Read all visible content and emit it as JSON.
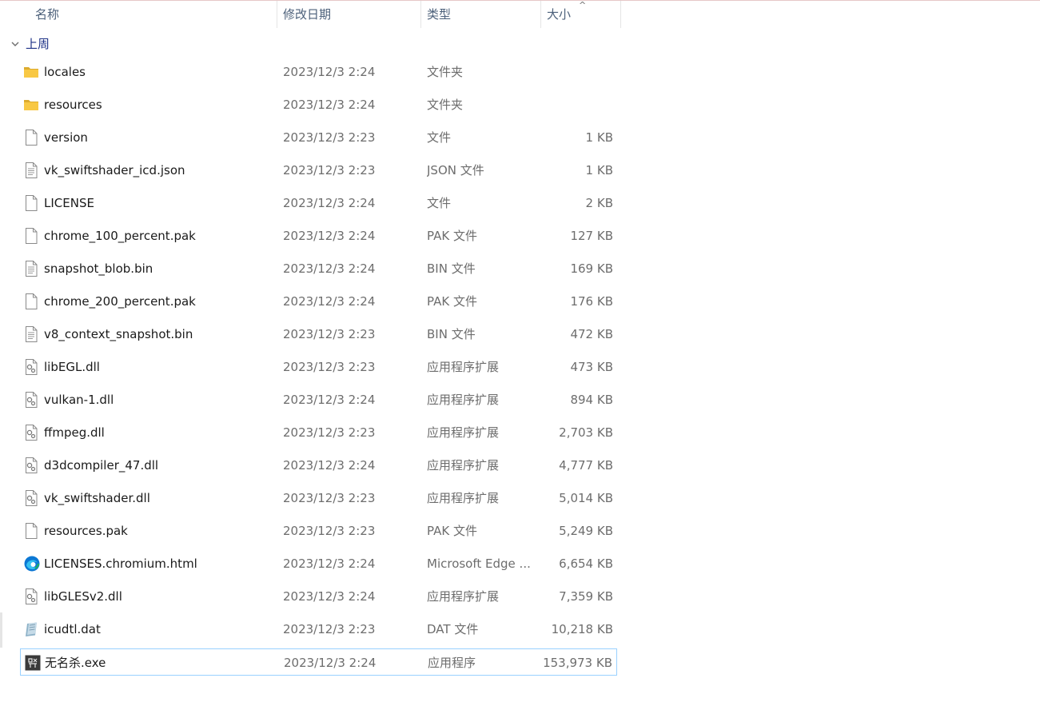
{
  "columns": {
    "name": "名称",
    "date": "修改日期",
    "type": "类型",
    "size": "大小"
  },
  "group": {
    "label": "上周"
  },
  "files": [
    {
      "name": "locales",
      "date": "2023/12/3 2:24",
      "type": "文件夹",
      "size": "",
      "icon": "folder-icon"
    },
    {
      "name": "resources",
      "date": "2023/12/3 2:24",
      "type": "文件夹",
      "size": "",
      "icon": "folder-icon"
    },
    {
      "name": "version",
      "date": "2023/12/3 2:23",
      "type": "文件",
      "size": "1 KB",
      "icon": "file-icon"
    },
    {
      "name": "vk_swiftshader_icd.json",
      "date": "2023/12/3 2:23",
      "type": "JSON 文件",
      "size": "1 KB",
      "icon": "text-file-icon"
    },
    {
      "name": "LICENSE",
      "date": "2023/12/3 2:24",
      "type": "文件",
      "size": "2 KB",
      "icon": "file-icon"
    },
    {
      "name": "chrome_100_percent.pak",
      "date": "2023/12/3 2:24",
      "type": "PAK 文件",
      "size": "127 KB",
      "icon": "file-icon"
    },
    {
      "name": "snapshot_blob.bin",
      "date": "2023/12/3 2:24",
      "type": "BIN 文件",
      "size": "169 KB",
      "icon": "text-file-icon"
    },
    {
      "name": "chrome_200_percent.pak",
      "date": "2023/12/3 2:24",
      "type": "PAK 文件",
      "size": "176 KB",
      "icon": "file-icon"
    },
    {
      "name": "v8_context_snapshot.bin",
      "date": "2023/12/3 2:23",
      "type": "BIN 文件",
      "size": "472 KB",
      "icon": "text-file-icon"
    },
    {
      "name": "libEGL.dll",
      "date": "2023/12/3 2:23",
      "type": "应用程序扩展",
      "size": "473 KB",
      "icon": "dll-icon"
    },
    {
      "name": "vulkan-1.dll",
      "date": "2023/12/3 2:24",
      "type": "应用程序扩展",
      "size": "894 KB",
      "icon": "dll-icon"
    },
    {
      "name": "ffmpeg.dll",
      "date": "2023/12/3 2:23",
      "type": "应用程序扩展",
      "size": "2,703 KB",
      "icon": "dll-icon"
    },
    {
      "name": "d3dcompiler_47.dll",
      "date": "2023/12/3 2:24",
      "type": "应用程序扩展",
      "size": "4,777 KB",
      "icon": "dll-icon"
    },
    {
      "name": "vk_swiftshader.dll",
      "date": "2023/12/3 2:23",
      "type": "应用程序扩展",
      "size": "5,014 KB",
      "icon": "dll-icon"
    },
    {
      "name": "resources.pak",
      "date": "2023/12/3 2:23",
      "type": "PAK 文件",
      "size": "5,249 KB",
      "icon": "file-icon"
    },
    {
      "name": "LICENSES.chromium.html",
      "date": "2023/12/3 2:24",
      "type": "Microsoft Edge ...",
      "size": "6,654 KB",
      "icon": "edge-icon"
    },
    {
      "name": "libGLESv2.dll",
      "date": "2023/12/3 2:24",
      "type": "应用程序扩展",
      "size": "7,359 KB",
      "icon": "dll-icon"
    },
    {
      "name": "icudtl.dat",
      "date": "2023/12/3 2:23",
      "type": "DAT 文件",
      "size": "10,218 KB",
      "icon": "dat-file-icon"
    },
    {
      "name": "无名杀.exe",
      "date": "2023/12/3 2:24",
      "type": "应用程序",
      "size": "153,973 KB",
      "icon": "exe-app-icon"
    }
  ],
  "selected_file": "无名杀.exe",
  "colors": {
    "header_text": "#4c607a",
    "group_text": "#1e3287",
    "secondary_text": "#6d6d6d",
    "selection_border": "#99d1ff",
    "folder": "#f8c844"
  }
}
